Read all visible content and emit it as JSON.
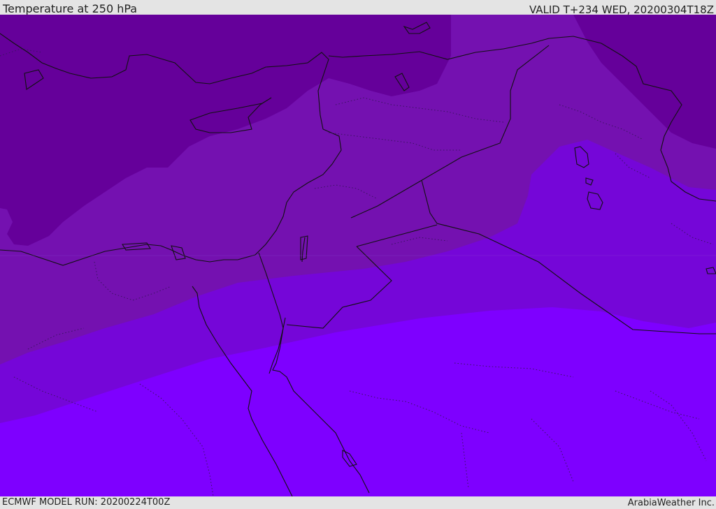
{
  "header": {
    "title": "Temperature at 250 hPa",
    "valid": "VALID T+234 WED, 20200304T18Z"
  },
  "footer": {
    "model_run": "ECMWF MODEL RUN: 20200224T00Z",
    "credit": "ArabiaWeather Inc."
  },
  "map": {
    "colors": {
      "coldest_band": "#65009a",
      "cold_band": "#7411b0",
      "mid_band": "#7506d8",
      "warm_band": "#7e00ff",
      "coastline": "#111111",
      "border_dotted": "#3a1460"
    }
  }
}
